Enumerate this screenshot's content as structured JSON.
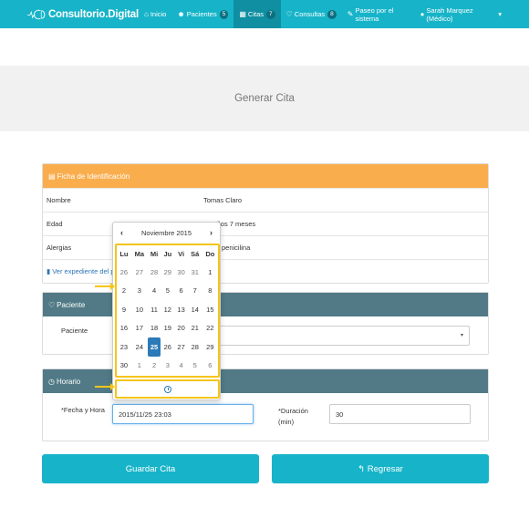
{
  "navbar": {
    "brand": "Consultorio.Digital",
    "items": [
      {
        "icon": "home-icon",
        "glyph": "⌂",
        "label": "Inicio",
        "badge": ""
      },
      {
        "icon": "users-icon",
        "glyph": "👥",
        "label": "Pacientes",
        "badge": "5"
      },
      {
        "icon": "calendar-icon",
        "glyph": "▦",
        "label": "Citas",
        "badge": "7"
      },
      {
        "icon": "stethoscope-icon",
        "glyph": "♡",
        "label": "Consultas",
        "badge": "8"
      },
      {
        "icon": "wand-icon",
        "glyph": "✎",
        "label": "Paseo por el sistema",
        "badge": ""
      }
    ],
    "user": "Sarah Marquez (Médico)",
    "user_icon": "user-icon"
  },
  "page": {
    "title": "Generar Cita"
  },
  "ident": {
    "heading": "Ficha de Identificación",
    "rows": [
      {
        "label": "Nombre",
        "value": "Tomas Claro"
      },
      {
        "label": "Edad",
        "value": "30 años 7 meses"
      },
      {
        "label": "Alergias",
        "value": "penicilina"
      }
    ],
    "link": "Ver expediente del paci"
  },
  "paciente": {
    "heading": "Paciente",
    "label": "Paciente",
    "value": ""
  },
  "horario": {
    "heading": "Horario",
    "fecha_label_req": "*",
    "fecha_label": "Fecha y Hora",
    "fecha_value": "2015/11/25 23:03",
    "duracion_label_req": "*",
    "duracion_label": "Duración",
    "duracion_label2": "(min)",
    "duracion_value": "30"
  },
  "buttons": {
    "save": "Guardar Cita",
    "back": "Regresar"
  },
  "datepicker": {
    "month": "Noviembre 2015",
    "prev": "‹",
    "next": "›",
    "weekdays": [
      "Lu",
      "Ma",
      "Mi",
      "Ju",
      "Vi",
      "Sá",
      "Do"
    ],
    "weeks": [
      [
        "26",
        "27",
        "28",
        "29",
        "30",
        "31",
        "1"
      ],
      [
        "2",
        "3",
        "4",
        "5",
        "6",
        "7",
        "8"
      ],
      [
        "9",
        "10",
        "11",
        "12",
        "13",
        "14",
        "15"
      ],
      [
        "16",
        "17",
        "18",
        "19",
        "20",
        "21",
        "22"
      ],
      [
        "23",
        "24",
        "25",
        "26",
        "27",
        "28",
        "29"
      ],
      [
        "30",
        "1",
        "2",
        "3",
        "4",
        "5",
        "6"
      ]
    ],
    "selected": "25"
  },
  "colors": {
    "navbar": "#17b4c9",
    "orange_heading": "#f9ad4d",
    "slate_heading": "#517a86",
    "highlight": "#f5c518",
    "selected_day": "#2c7ab8"
  }
}
